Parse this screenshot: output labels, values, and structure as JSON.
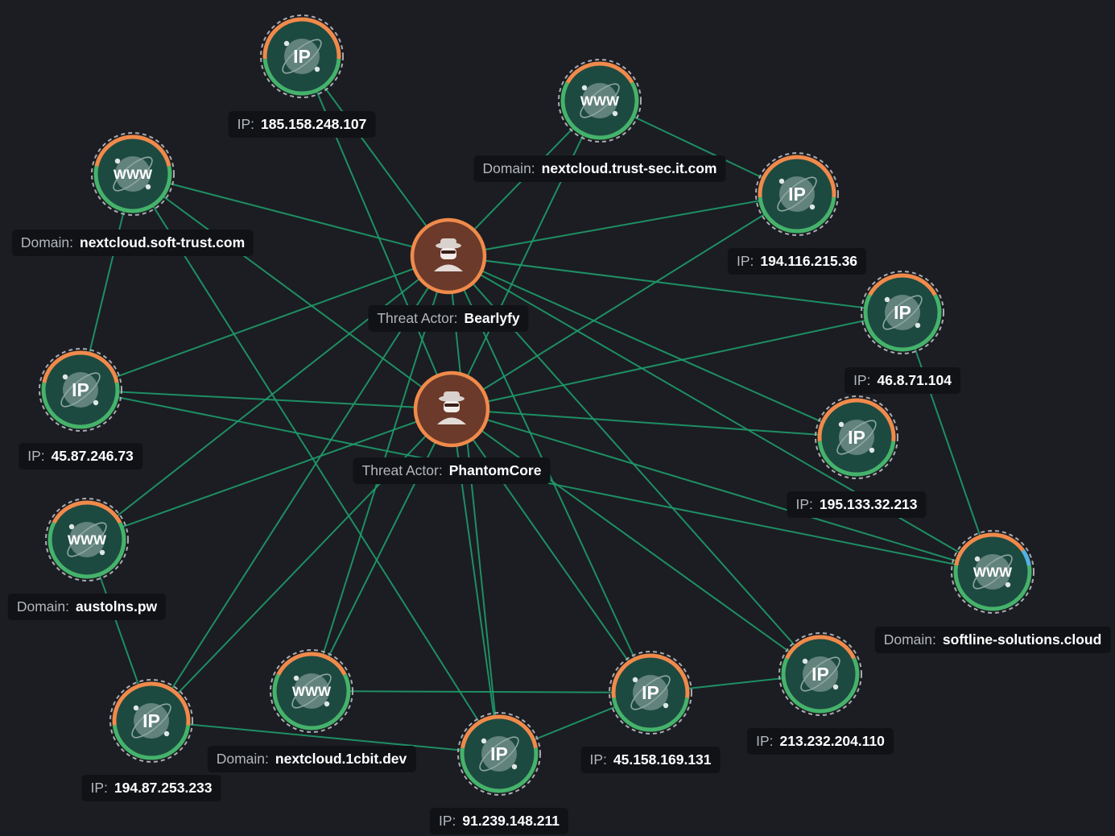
{
  "colors": {
    "background": "#1b1d22",
    "edge": "#1f9b6a",
    "node_fill": "#1d4a40",
    "ring_orange": "#f08a4b",
    "ring_green": "#45b36b",
    "ring_blue": "#4fb3e8",
    "actor_fill": "#6b3a2a",
    "actor_ring": "#f08a4b",
    "label_bg": "#101216"
  },
  "icons": {
    "ip": "ip-globe-icon",
    "domain": "www-globe-icon",
    "actor": "hacker-icon"
  },
  "node_kinds": {
    "ip": {
      "prefix": "IP:",
      "glyph": "IP"
    },
    "domain": {
      "prefix": "Domain:",
      "glyph": "WWW"
    },
    "actor": {
      "prefix": "Threat Actor:",
      "glyph": ""
    }
  },
  "nodes": [
    {
      "id": "bearlyfy",
      "kind": "actor",
      "value": "Bearlyfy"
    },
    {
      "id": "phantomcore",
      "kind": "actor",
      "value": "PhantomCore"
    },
    {
      "id": "ip185",
      "kind": "ip",
      "value": "185.158.248.107"
    },
    {
      "id": "dom_trustsec",
      "kind": "domain",
      "value": "nextcloud.trust-sec.it.com"
    },
    {
      "id": "dom_softtrust",
      "kind": "domain",
      "value": "nextcloud.soft-trust.com"
    },
    {
      "id": "ip194_116",
      "kind": "ip",
      "value": "194.116.215.36"
    },
    {
      "id": "ip46",
      "kind": "ip",
      "value": "46.8.71.104"
    },
    {
      "id": "ip45_87",
      "kind": "ip",
      "value": "45.87.246.73"
    },
    {
      "id": "ip195",
      "kind": "ip",
      "value": "195.133.32.213"
    },
    {
      "id": "dom_austolns",
      "kind": "domain",
      "value": "austolns.pw"
    },
    {
      "id": "dom_softline",
      "kind": "domain",
      "value": "softline-solutions.cloud"
    },
    {
      "id": "ip194_87",
      "kind": "ip",
      "value": "194.87.253.233"
    },
    {
      "id": "dom_1cbit",
      "kind": "domain",
      "value": "nextcloud.1cbit.dev"
    },
    {
      "id": "ip91",
      "kind": "ip",
      "value": "91.239.148.211"
    },
    {
      "id": "ip45_158",
      "kind": "ip",
      "value": "45.158.169.131"
    },
    {
      "id": "ip213",
      "kind": "ip",
      "value": "213.232.204.110"
    }
  ],
  "edges": [
    [
      "bearlyfy",
      "ip185"
    ],
    [
      "bearlyfy",
      "dom_trustsec"
    ],
    [
      "bearlyfy",
      "dom_softtrust"
    ],
    [
      "bearlyfy",
      "ip194_116"
    ],
    [
      "bearlyfy",
      "ip46"
    ],
    [
      "bearlyfy",
      "ip45_87"
    ],
    [
      "bearlyfy",
      "ip195"
    ],
    [
      "bearlyfy",
      "dom_austolns"
    ],
    [
      "bearlyfy",
      "dom_softline"
    ],
    [
      "bearlyfy",
      "ip194_87"
    ],
    [
      "bearlyfy",
      "dom_1cbit"
    ],
    [
      "bearlyfy",
      "ip91"
    ],
    [
      "bearlyfy",
      "ip45_158"
    ],
    [
      "bearlyfy",
      "ip213"
    ],
    [
      "phantomcore",
      "ip185"
    ],
    [
      "phantomcore",
      "dom_trustsec"
    ],
    [
      "phantomcore",
      "dom_softtrust"
    ],
    [
      "phantomcore",
      "ip194_116"
    ],
    [
      "phantomcore",
      "ip46"
    ],
    [
      "phantomcore",
      "ip45_87"
    ],
    [
      "phantomcore",
      "ip195"
    ],
    [
      "phantomcore",
      "dom_austolns"
    ],
    [
      "phantomcore",
      "dom_softline"
    ],
    [
      "phantomcore",
      "ip194_87"
    ],
    [
      "phantomcore",
      "dom_1cbit"
    ],
    [
      "phantomcore",
      "ip91"
    ],
    [
      "phantomcore",
      "ip45_158"
    ],
    [
      "phantomcore",
      "ip213"
    ],
    [
      "dom_trustsec",
      "ip194_116"
    ],
    [
      "dom_softtrust",
      "ip45_87"
    ],
    [
      "dom_softtrust",
      "ip91"
    ],
    [
      "ip45_87",
      "dom_softline"
    ],
    [
      "ip46",
      "dom_softline"
    ],
    [
      "ip194_87",
      "dom_austolns"
    ],
    [
      "dom_1cbit",
      "ip45_158"
    ],
    [
      "ip45_158",
      "ip213"
    ],
    [
      "ip194_87",
      "ip91"
    ],
    [
      "ip91",
      "ip45_158"
    ]
  ]
}
